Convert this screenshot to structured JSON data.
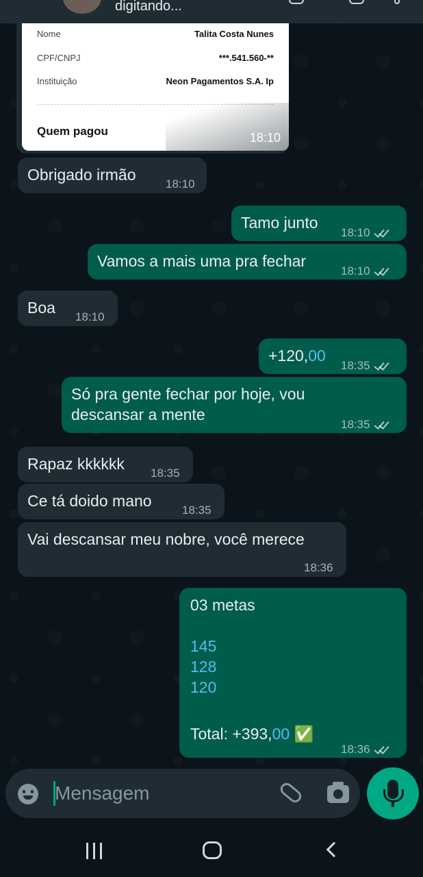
{
  "header": {
    "status": "digitando..."
  },
  "receipt": {
    "rows": [
      {
        "label": "Nome",
        "value": "Talita Costa Nunes"
      },
      {
        "label": "CPF/CNPJ",
        "value": "***.541.560-**"
      },
      {
        "label": "Instituição",
        "value": "Neon Pagamentos S.A. Ip"
      }
    ],
    "paid_by": "Quem pagou",
    "time": "18:10"
  },
  "messages": [
    {
      "text": "Obrigado irmão",
      "time": "18:10"
    },
    {
      "text": "Tamo junto",
      "time": "18:10"
    },
    {
      "text": "Vamos a mais uma pra fechar",
      "time": "18:10"
    },
    {
      "text": "Boa",
      "time": "18:10"
    },
    {
      "text_prefix": "+120,",
      "text_suffix": "00",
      "time": "18:35"
    },
    {
      "text": "Só pra gente fechar por hoje, vou descansar a mente",
      "time": "18:35"
    },
    {
      "text": "Rapaz kkkkkk",
      "time": "18:35"
    },
    {
      "text": "Ce tá doido mano",
      "time": "18:35"
    },
    {
      "text": "Vai descansar meu nobre, você merece",
      "time": "18:36"
    }
  ],
  "summary": {
    "title": "03 metas",
    "values": [
      "145",
      "128",
      "120"
    ],
    "total_prefix": "Total: +393,",
    "total_suffix": "00",
    "check": "✅",
    "time": "18:36"
  },
  "input": {
    "placeholder": "Mensagem"
  },
  "colors": {
    "incoming": "#1f2c34",
    "outgoing": "#005c4b",
    "accent": "#00a884",
    "link": "#53bdeb"
  }
}
